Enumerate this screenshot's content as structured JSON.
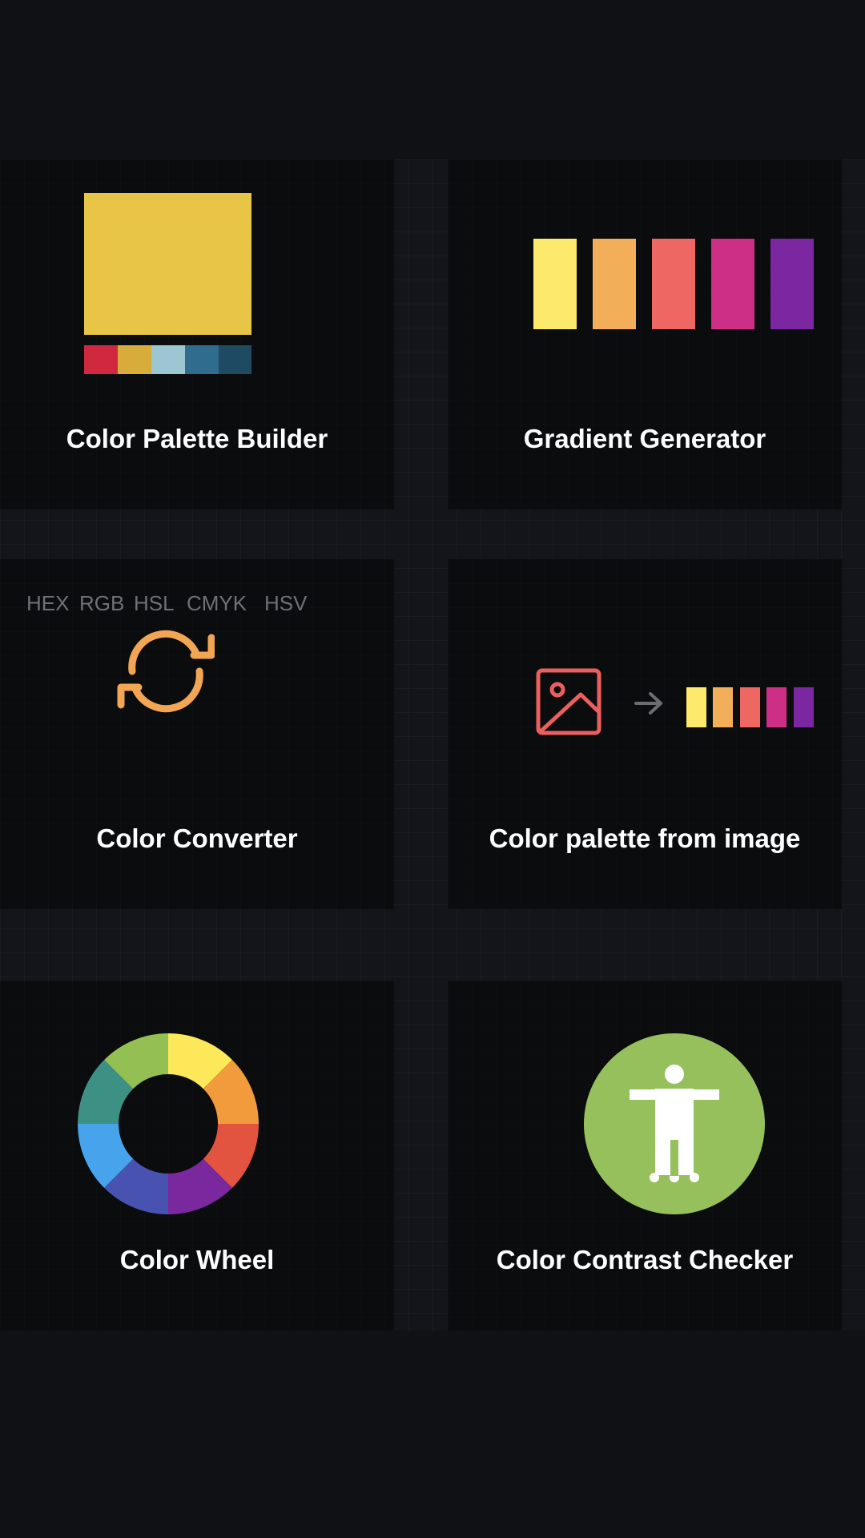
{
  "cards": [
    {
      "title": "Color Palette Builder",
      "icon": "palette-swatch-icon"
    },
    {
      "title": "Gradient Generator",
      "icon": "gradient-bars-icon"
    },
    {
      "title": "Color Converter",
      "icon": "refresh-arrows-icon"
    },
    {
      "title": "Color palette from image",
      "icon": "image-to-palette-icon"
    },
    {
      "title": "Color Wheel",
      "icon": "color-wheel-icon"
    },
    {
      "title": "Color Contrast Checker",
      "icon": "accessibility-icon"
    }
  ],
  "converter_formats": [
    "HEX",
    "RGB",
    "HSL",
    "CMYK",
    "HSV"
  ],
  "colors": {
    "palette_main": "#E8C547",
    "palette_swatches": [
      "#D0283F",
      "#D8AC3B",
      "#9CC6D2",
      "#2F6C8E",
      "#1E4B62"
    ],
    "gradient": [
      "#FDE96B",
      "#F2AE58",
      "#EE6763",
      "#CC2F85",
      "#7A27A1"
    ],
    "converter_icon": "#F2A654",
    "image_icon": "#EC5F5F",
    "arrow": "#6B6D73",
    "wheel": [
      "#FDE859",
      "#F19B3C",
      "#E35440",
      "#7A289E",
      "#4852B0",
      "#47A4EC",
      "#3C9184",
      "#94BF52"
    ],
    "contrast_circle": "#96C05C"
  }
}
